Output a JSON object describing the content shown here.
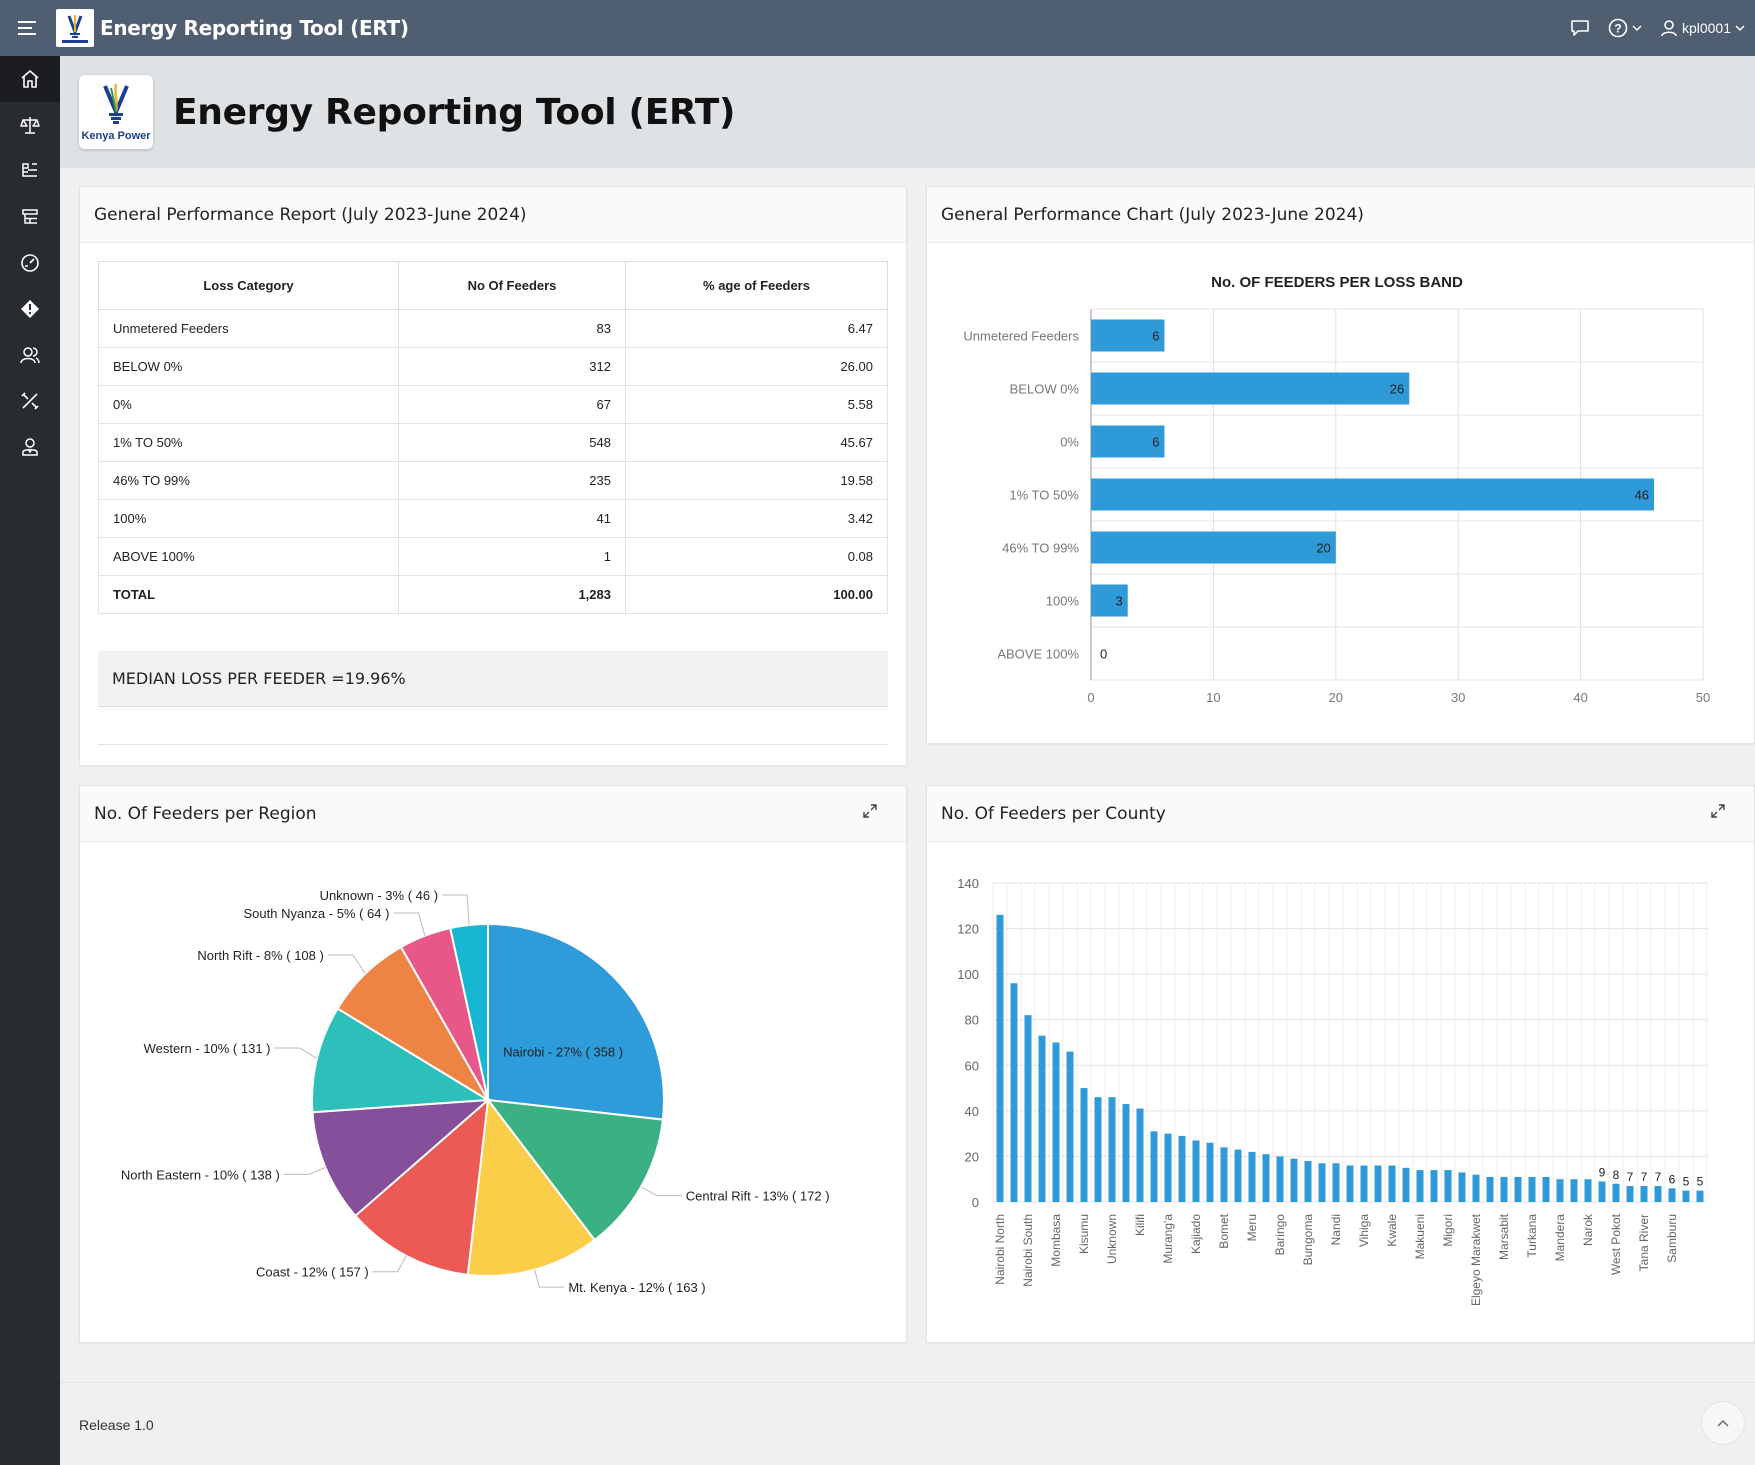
{
  "app": {
    "title": "Energy Reporting Tool (ERT)",
    "logo_text": "Kenya Power",
    "user": "kpl0001"
  },
  "hero": {
    "title": "Energy Reporting Tool (ERT)"
  },
  "sidebar": {
    "items": [
      {
        "icon": "home-icon"
      },
      {
        "icon": "scale-icon"
      },
      {
        "icon": "hierarchy-icon"
      },
      {
        "icon": "tree-list-icon"
      },
      {
        "icon": "dashboard-icon"
      },
      {
        "icon": "diamond-alert-icon"
      },
      {
        "icon": "users-icon"
      },
      {
        "icon": "tools-icon"
      },
      {
        "icon": "user-admin-icon"
      }
    ]
  },
  "report": {
    "title": "General Performance Report (July 2023-June 2024)",
    "headers": [
      "Loss Category",
      "No Of Feeders",
      "% age of Feeders"
    ],
    "rows": [
      [
        "Unmetered Feeders",
        "83",
        "6.47"
      ],
      [
        "BELOW 0%",
        "312",
        "26.00"
      ],
      [
        "0%",
        "67",
        "5.58"
      ],
      [
        "1% TO 50%",
        "548",
        "45.67"
      ],
      [
        "46% TO 99%",
        "235",
        "19.58"
      ],
      [
        "100%",
        "41",
        "3.42"
      ],
      [
        "ABOVE 100%",
        "1",
        "0.08"
      ]
    ],
    "total": [
      "TOTAL",
      "1,283",
      "100.00"
    ],
    "median": "MEDIAN LOSS PER FEEDER =19.96%"
  },
  "perf_chart": {
    "card_title": "General Performance Chart (July 2023-June 2024)"
  },
  "region_card": {
    "title": "No. Of Feeders per Region"
  },
  "county_card": {
    "title": "No. Of Feeders per County"
  },
  "footer": {
    "release": "Release 1.0"
  },
  "chart_data": [
    {
      "type": "bar",
      "orientation": "horizontal",
      "title": "No. OF FEEDERS PER LOSS BAND",
      "categories": [
        "Unmetered Feeders",
        "BELOW 0%",
        "0%",
        "1% TO 50%",
        "46% TO 99%",
        "100%",
        "ABOVE 100%"
      ],
      "values": [
        6,
        26,
        6,
        46,
        20,
        3,
        0
      ],
      "xlim": [
        0,
        50
      ],
      "xticks": [
        0,
        10,
        20,
        30,
        40,
        50
      ],
      "color": "#2e9ad8",
      "grid": true
    },
    {
      "type": "pie",
      "slices": [
        {
          "label": "Nairobi - 27% ( 358 )",
          "value": 358,
          "color": "#2e9bdb"
        },
        {
          "label": "Central Rift - 13% ( 172 )",
          "value": 172,
          "color": "#3bb183"
        },
        {
          "label": "Mt. Kenya - 12% ( 163 )",
          "value": 163,
          "color": "#fbce4a"
        },
        {
          "label": "Coast - 12% ( 157 )",
          "value": 157,
          "color": "#ec5a56"
        },
        {
          "label": "North Eastern - 10% ( 138 )",
          "value": 138,
          "color": "#864f9b"
        },
        {
          "label": "Western - 10% ( 131 )",
          "value": 131,
          "color": "#2dbfba"
        },
        {
          "label": "North Rift - 8% ( 108 )",
          "value": 108,
          "color": "#ee8443"
        },
        {
          "label": "South Nyanza - 5% ( 64 )",
          "value": 64,
          "color": "#e8578a"
        },
        {
          "label": "Unknown - 3% ( 46 )",
          "value": 46,
          "color": "#17b7d3"
        }
      ]
    },
    {
      "type": "bar",
      "orientation": "vertical",
      "categories": [
        "Nairobi North",
        "",
        "Nairobi South",
        "",
        "Mombasa",
        "",
        "Kisumu",
        "",
        "Unknown",
        "",
        "Kilifi",
        "",
        "Murang'a",
        "",
        "Kajiado",
        "",
        "Bomet",
        "",
        "Meru",
        "",
        "Baringo",
        "",
        "Bungoma",
        "",
        "Nandi",
        "",
        "Vihiga",
        "",
        "Kwale",
        "",
        "Makueni",
        "",
        "Migori",
        "",
        "Elgeyo Marakwet",
        "",
        "Marsabit",
        "",
        "Turkana",
        "",
        "Mandera",
        "",
        "Narok",
        "",
        "West Pokot",
        "",
        "Tana River",
        "",
        "Samburu",
        ""
      ],
      "values": [
        126,
        96,
        82,
        73,
        70,
        66,
        50,
        46,
        46,
        43,
        41,
        31,
        30,
        29,
        27,
        26,
        24,
        23,
        22,
        21,
        20,
        19,
        18,
        17,
        17,
        16,
        16,
        16,
        16,
        15,
        14,
        14,
        14,
        13,
        12,
        11,
        11,
        11,
        11,
        11,
        10,
        10,
        10,
        9,
        8,
        7,
        7,
        7,
        6,
        5,
        5
      ],
      "data_labels": {
        "43": "9",
        "44": "8",
        "45": "7",
        "46": "7",
        "47": "7",
        "48": "6",
        "49": "5",
        "50": "5"
      },
      "ylim": [
        0,
        140
      ],
      "yticks": [
        0,
        20,
        40,
        60,
        80,
        100,
        120,
        140
      ],
      "color": "#2e9ad8",
      "grid": true
    }
  ]
}
